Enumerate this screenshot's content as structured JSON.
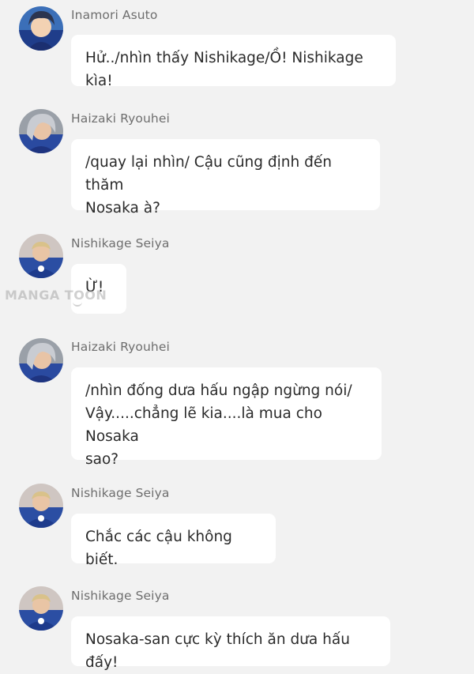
{
  "watermark": "MANGA TOON",
  "messages": [
    {
      "sender": "Inamori Asuto",
      "avatar": "inamori-avatar",
      "lines": [
        "Hử../nhìn thấy Nishikage/Ồ! Nishikage kìa!"
      ]
    },
    {
      "sender": "Haizaki Ryouhei",
      "avatar": "haizaki-avatar",
      "lines": [
        "/quay lại nhìn/ Cậu cũng định đến thăm",
        "Nosaka à?"
      ]
    },
    {
      "sender": "Nishikage Seiya",
      "avatar": "nishikage-avatar",
      "lines": [
        "Ừ!"
      ]
    },
    {
      "sender": "Haizaki Ryouhei",
      "avatar": "haizaki-avatar",
      "lines": [
        "/nhìn đống dưa hấu ngập ngừng nói/",
        "Vậy.....chẳng lẽ kia....là mua cho Nosaka",
        "sao?"
      ]
    },
    {
      "sender": "Nishikage Seiya",
      "avatar": "nishikage-avatar",
      "lines": [
        "Chắc các cậu không biết."
      ]
    },
    {
      "sender": "Nishikage Seiya",
      "avatar": "nishikage-avatar",
      "lines": [
        "Nosaka-san cực kỳ thích ăn dưa hấu đấy!"
      ]
    }
  ],
  "colors": {
    "background": "#f2f2f2",
    "bubble": "#ffffff",
    "sender_text": "#6e6e6e",
    "message_text": "#2b2b2b"
  }
}
